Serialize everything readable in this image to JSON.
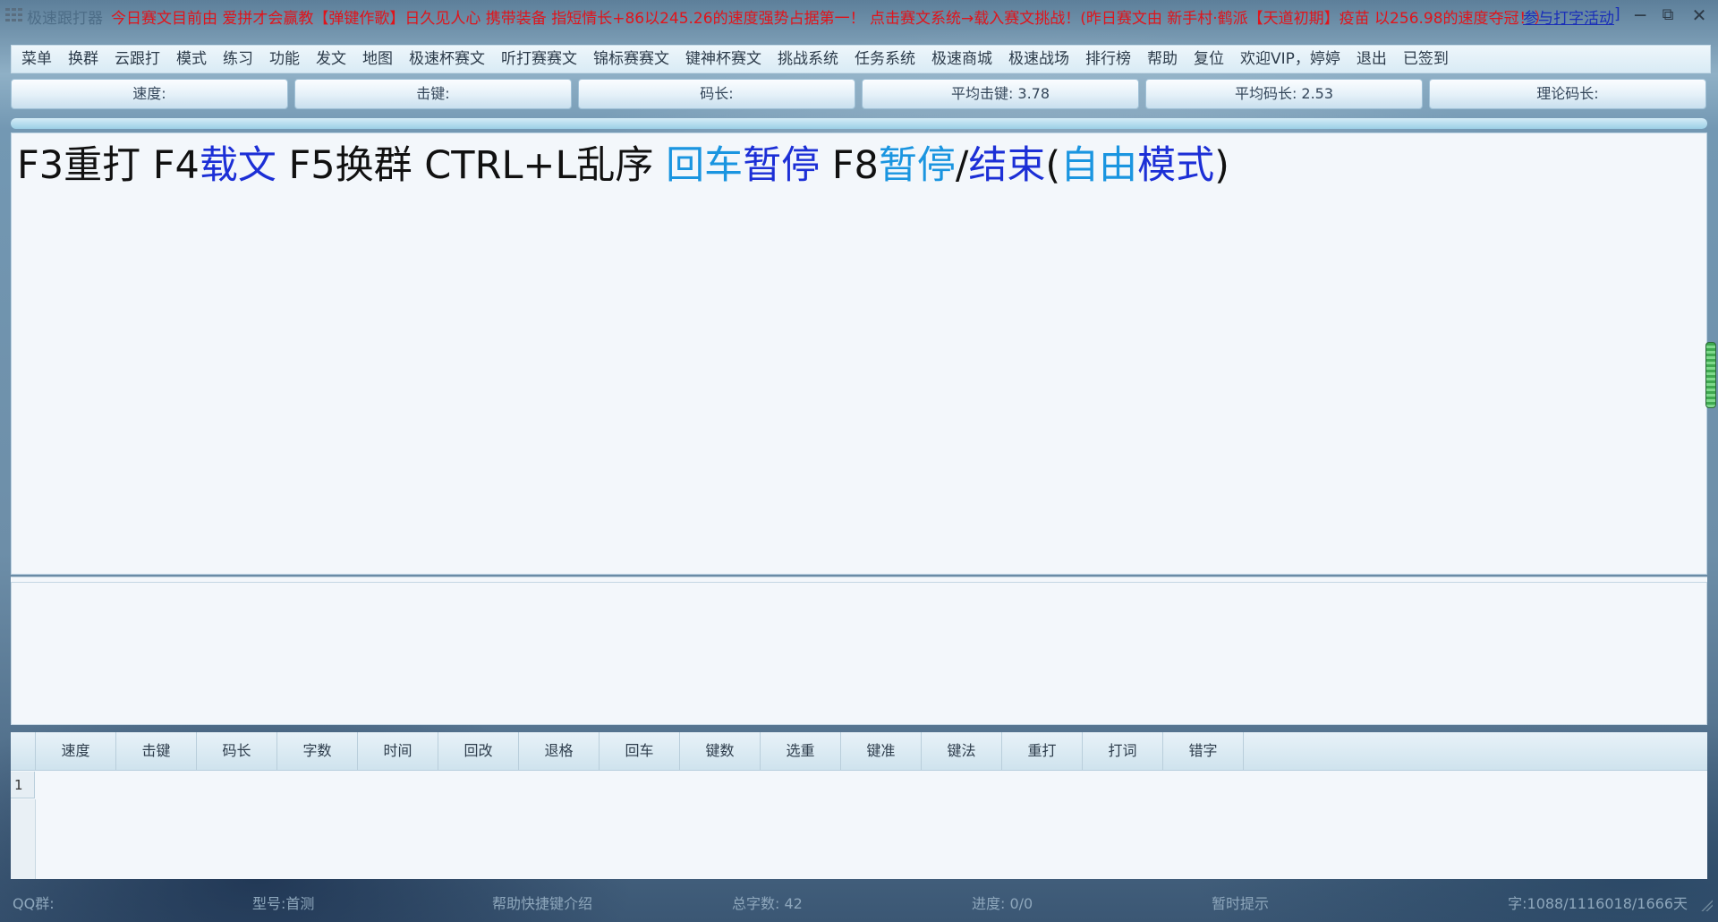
{
  "titlebar": {
    "app_title": "极速跟打器",
    "marquee": "今日赛文目前由 爱拼才会赢教【弹键作歌】日久见人心 携带装备 指短情长+86以245.26的速度强势占据第一！ 点击赛文系统→载入赛文挑战！(昨日赛文由 新手村·鹤派【天道初期】疫苗 以256.98的速度夺冠！）",
    "activity_link": "参与打字活动",
    "link_bracket": "]",
    "minimize_glyph": "─",
    "restore_glyph": "⧉",
    "close_glyph": "✕"
  },
  "menu": [
    "菜单",
    "换群",
    "云跟打",
    "模式",
    "练习",
    "功能",
    "发文",
    "地图",
    "极速杯赛文",
    "听打赛赛文",
    "锦标赛赛文",
    "键神杯赛文",
    "挑战系统",
    "任务系统",
    "极速商城",
    "极速战场",
    "排行榜",
    "帮助",
    "复位",
    "欢迎VIP，婷婷",
    "退出",
    "已签到"
  ],
  "stats": {
    "speed": "速度:",
    "keystroke": "击键:",
    "code_length": "码长:",
    "avg_keystroke": "平均击键: 3.78",
    "avg_code_length": "平均码长: 2.53",
    "theory_code_length": "理论码长:"
  },
  "hint": {
    "p1": "F3重打 F4",
    "p2": "载文",
    "p3": " F5换群 CTRL+L乱序 ",
    "p4": "回车",
    "p5": "暂停",
    "p6": " F8",
    "p7": "暂停",
    "p8": "/",
    "p9": "结束",
    "p10": "(",
    "p11": "自由",
    "p12": "模式",
    "p13": ")"
  },
  "results": {
    "columns": [
      "速度",
      "击键",
      "码长",
      "字数",
      "时间",
      "回改",
      "退格",
      "回车",
      "键数",
      "选重",
      "键准",
      "键法",
      "重打",
      "打词",
      "错字"
    ],
    "rows": [
      {
        "num": "1"
      }
    ]
  },
  "status": {
    "qq_group": "QQ群:",
    "item2": "型号:首测",
    "shortcut_intro": "帮助快捷键介绍",
    "total_chars": "总字数: 42",
    "progress": "进度: 0/0",
    "tip": "暂时提示",
    "counter": "字:1088/1116018/1666天"
  },
  "colors": {
    "marquee": "#e0141b",
    "link": "#1a2fb8",
    "hint_navy": "#1c2fd6",
    "hint_cyan": "#1a95e0",
    "scroll_thumb": "#3ea84f"
  }
}
